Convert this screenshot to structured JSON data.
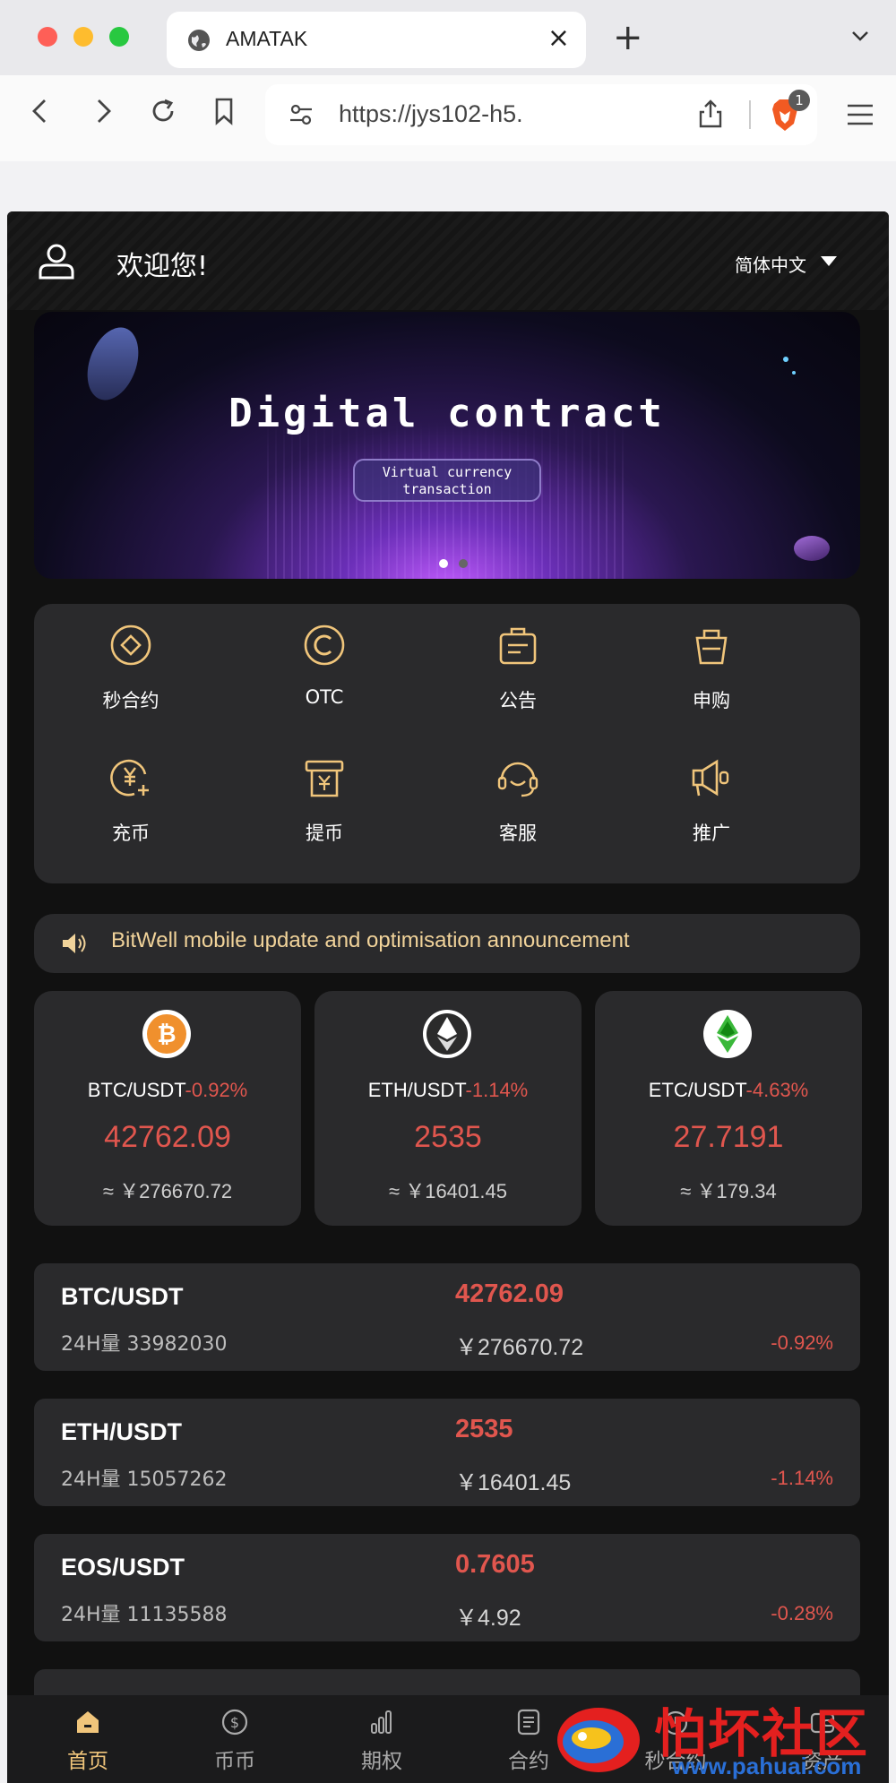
{
  "browser": {
    "tab_title": "AMATAK",
    "url": "https://jys102-h5.",
    "extension_badge": "1"
  },
  "header": {
    "welcome": "欢迎您!",
    "language": "简体中文"
  },
  "banner": {
    "title": "Digital contract",
    "subtitle_line1": "Virtual currency",
    "subtitle_line2": "transaction",
    "slide_count": 2,
    "active_slide": 1
  },
  "shortcuts": [
    {
      "label": "秒合约",
      "icon": "diamond-icon"
    },
    {
      "label": "OTC",
      "icon": "copyright-icon"
    },
    {
      "label": "公告",
      "icon": "bag-icon"
    },
    {
      "label": "申购",
      "icon": "basket-icon"
    },
    {
      "label": "充币",
      "icon": "yen-plus-icon"
    },
    {
      "label": "提币",
      "icon": "atm-icon"
    },
    {
      "label": "客服",
      "icon": "headset-icon"
    },
    {
      "label": "推广",
      "icon": "megaphone-icon"
    }
  ],
  "notice": {
    "text": "BitWell mobile update and optimisation announcement"
  },
  "featured": [
    {
      "pair": "BTC/USDT",
      "change": "-0.92%",
      "price": "42762.09",
      "cny": "≈ ￥276670.72",
      "icon": "bitcoin-icon"
    },
    {
      "pair": "ETH/USDT",
      "change": "-1.14%",
      "price": "2535",
      "cny": "≈ ￥16401.45",
      "icon": "ethereum-icon"
    },
    {
      "pair": "ETC/USDT",
      "change": "-4.63%",
      "price": "27.7191",
      "cny": "≈ ￥179.34",
      "icon": "ethereum-classic-icon"
    }
  ],
  "market": [
    {
      "pair": "BTC/USDT",
      "volume": "24H量 33982030",
      "price": "42762.09",
      "cny": "￥276670.72",
      "change": "-0.92%"
    },
    {
      "pair": "ETH/USDT",
      "volume": "24H量 15057262",
      "price": "2535",
      "cny": "￥16401.45",
      "change": "-1.14%"
    },
    {
      "pair": "EOS/USDT",
      "volume": "24H量 11135588",
      "price": "0.7605",
      "cny": "￥4.92",
      "change": "-0.28%"
    }
  ],
  "bottom_nav": [
    {
      "label": "首页",
      "icon": "home-icon",
      "active": true
    },
    {
      "label": "币币",
      "icon": "dollar-coin-icon",
      "active": false
    },
    {
      "label": "期权",
      "icon": "bar-chart-icon",
      "active": false
    },
    {
      "label": "合约",
      "icon": "document-icon",
      "active": false
    },
    {
      "label": "秒合约",
      "icon": "timer-icon",
      "active": false
    },
    {
      "label": "资产",
      "icon": "wallet-icon",
      "active": false
    }
  ],
  "watermark": {
    "text": "怕坏社区",
    "url": "www.pahuai.com"
  },
  "colors": {
    "accent_gold": "#f0c57b",
    "down_red": "#e0564e",
    "panel": "#2a2a2c",
    "background": "#111111"
  }
}
